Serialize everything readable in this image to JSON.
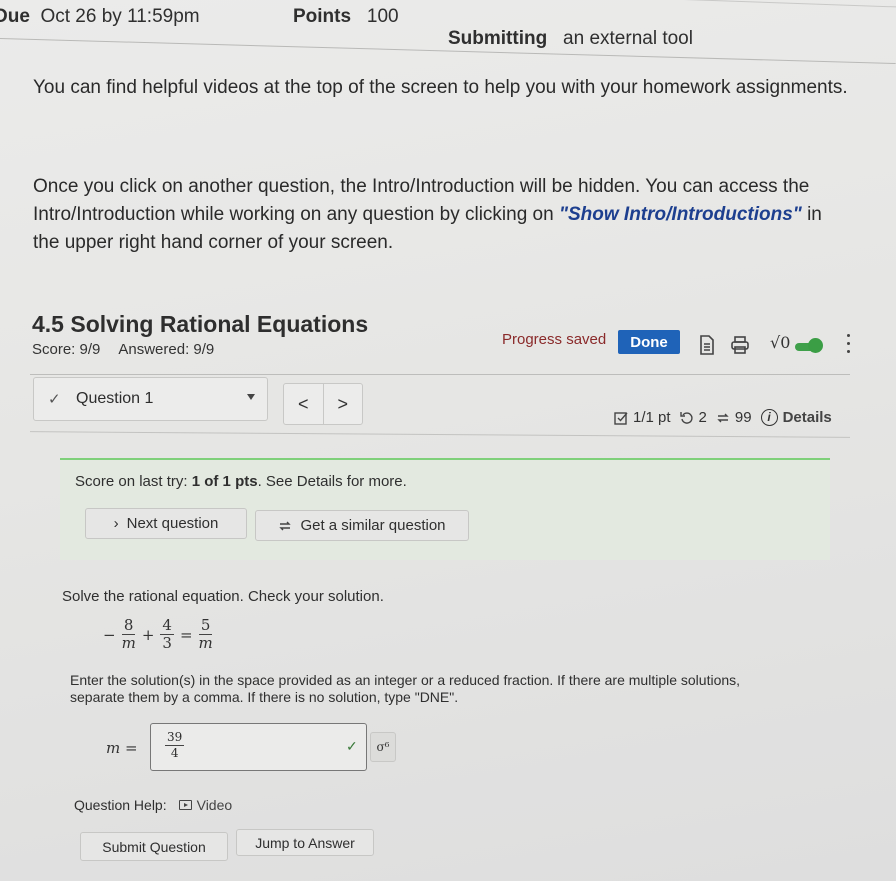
{
  "meta": {
    "due_label": "Due",
    "due_value": "Oct 26 by 11:59pm",
    "points_label": "Points",
    "points_value": "100",
    "submitting_label": "Submitting",
    "submitting_value": "an external tool"
  },
  "intro": {
    "paragraph1": "You can find helpful videos at the top of the screen to help you with your homework assignments.",
    "paragraph2_before": "Once you click on another question, the Intro/Introduction will be hidden. You can access the Intro/Introduction while working on any question by clicking on ",
    "paragraph2_link": "\"Show Intro/Introductions\"",
    "paragraph2_after": " in the upper right hand corner of your screen."
  },
  "assignment": {
    "title": "4.5 Solving Rational Equations",
    "score": "Score: 9/9",
    "answered": "Answered: 9/9",
    "progress_status": "Progress saved",
    "done_label": "Done",
    "math_toggle_label": "√0",
    "math_toggle_on": true
  },
  "question_nav": {
    "selected": "Question 1",
    "check_mark": "✓",
    "prev": "<",
    "next": ">"
  },
  "question_stats": {
    "points": "1/1 pt",
    "retries": "2",
    "similar_remaining": "99",
    "details_label": "Details"
  },
  "result": {
    "prefix": "Score on last try: ",
    "score": "1 of 1 pts",
    "suffix": ". See Details for more.",
    "next_question_label": "Next question",
    "similar_question_label": "Get a similar question"
  },
  "question": {
    "prompt": "Solve the rational equation. Check your solution.",
    "equation": {
      "sign": "−",
      "term1_num": "8",
      "term1_den": "m",
      "op1": "+",
      "term2_num": "4",
      "term2_den": "3",
      "op2": "=",
      "term3_num": "5",
      "term3_den": "m"
    },
    "instructions": "Enter the solution(s) in the space provided as an integer or a reduced fraction. If there are multiple solutions, separate them by a comma. If there is no solution, type \"DNE\".",
    "answer_variable": "m",
    "answer_equals": "=",
    "answer_num": "39",
    "answer_den": "4",
    "answer_correct": true,
    "preview_label": "σ⁶"
  },
  "help": {
    "label": "Question Help:",
    "video_label": "Video"
  },
  "actions": {
    "submit_label": "Submit Question",
    "jump_label": "Jump to Answer"
  }
}
